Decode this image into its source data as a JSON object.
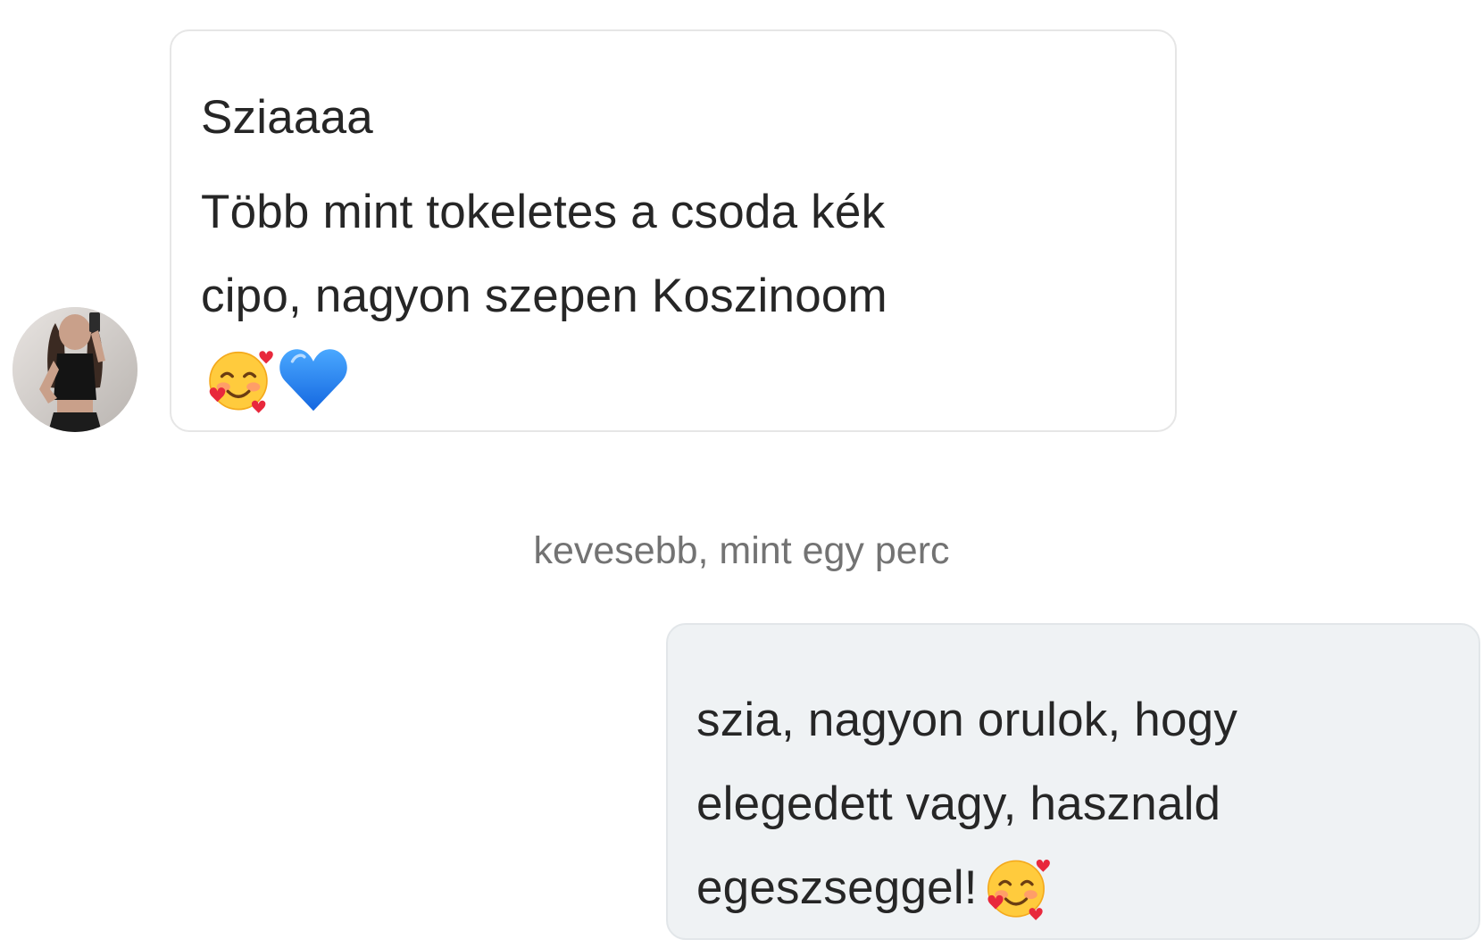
{
  "conversation": {
    "incoming": {
      "lines": [
        "Sziaaaa",
        "Több mint tokeletes a csoda kék",
        "cipo, nagyon szepen Koszinoom"
      ],
      "emojis": [
        "smiling-face-with-hearts-icon",
        "blue-heart-icon"
      ]
    },
    "timestamp": "kevesebb, mint egy perc",
    "outgoing": {
      "lines": [
        "szia, nagyon orulok, hogy",
        "elegedett vagy, hasznald",
        "egeszseggel!"
      ],
      "emojis": [
        "smiling-face-with-hearts-icon"
      ]
    }
  },
  "colors": {
    "incoming_bubble": "#ffffff",
    "outgoing_bubble": "#eff2f4",
    "text": "#262626",
    "timestamp": "#737373",
    "blue_heart": "#1e90ff"
  }
}
